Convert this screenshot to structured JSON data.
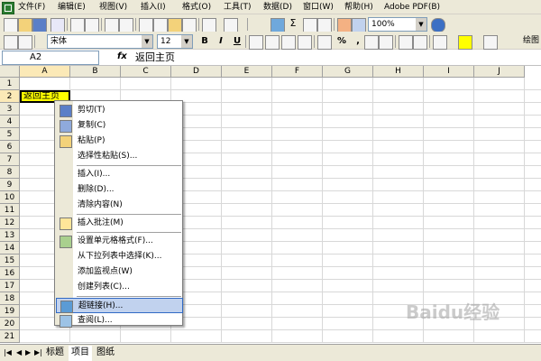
{
  "menubar": {
    "items": [
      "文件(F)",
      "编辑(E)",
      "视图(V)",
      "插入(I)",
      "格式(O)",
      "工具(T)",
      "数据(D)",
      "窗口(W)",
      "帮助(H)",
      "Adobe PDF(B)"
    ]
  },
  "toolbar": {
    "zoom": "100%",
    "font_name": "宋体",
    "font_size": "12",
    "bold": "B",
    "italic": "I",
    "underline": "U",
    "percent": "%",
    "comma": ",",
    "sigma": "Σ",
    "right_label": "绘图"
  },
  "formula": {
    "name_box": "A2",
    "fx": "fx",
    "value": "返回主页"
  },
  "grid": {
    "columns": [
      "A",
      "B",
      "C",
      "D",
      "E",
      "F",
      "G",
      "H",
      "I",
      "J"
    ],
    "rows": [
      "1",
      "2",
      "3",
      "4",
      "5",
      "6",
      "7",
      "8",
      "9",
      "10",
      "11",
      "12",
      "13",
      "14",
      "15",
      "16",
      "17",
      "18",
      "19",
      "20",
      "21"
    ],
    "active_cell_value": "返回主页"
  },
  "context_menu": {
    "items": [
      {
        "label": "剪切(T)",
        "icon": "scissors-icon"
      },
      {
        "label": "复制(C)",
        "icon": "copy-icon"
      },
      {
        "label": "粘贴(P)",
        "icon": "paste-icon"
      },
      {
        "label": "选择性粘贴(S)...",
        "icon": ""
      },
      {
        "label": "插入(I)...",
        "icon": ""
      },
      {
        "label": "删除(D)...",
        "icon": ""
      },
      {
        "label": "清除内容(N)",
        "icon": ""
      },
      {
        "label": "插入批注(M)",
        "icon": "comment-icon"
      },
      {
        "label": "设置单元格格式(F)...",
        "icon": "format-cells-icon"
      },
      {
        "label": "从下拉列表中选择(K)...",
        "icon": ""
      },
      {
        "label": "添加监视点(W)",
        "icon": ""
      },
      {
        "label": "创建列表(C)...",
        "icon": ""
      },
      {
        "label": "超链接(H)...",
        "icon": "hyperlink-icon"
      },
      {
        "label": "查阅(L)...",
        "icon": "research-icon"
      }
    ],
    "highlighted": "超链接(H)..."
  },
  "sheets": {
    "tabs": [
      "标题",
      "项目",
      "图纸"
    ],
    "active": "项目"
  },
  "watermark": "Baidu经验",
  "colors": {
    "chrome": "#ece9d8",
    "active_cell_fill": "#ffff00",
    "menu_highlight": "#c1d2ee",
    "menu_highlight_border": "#316ac5"
  }
}
